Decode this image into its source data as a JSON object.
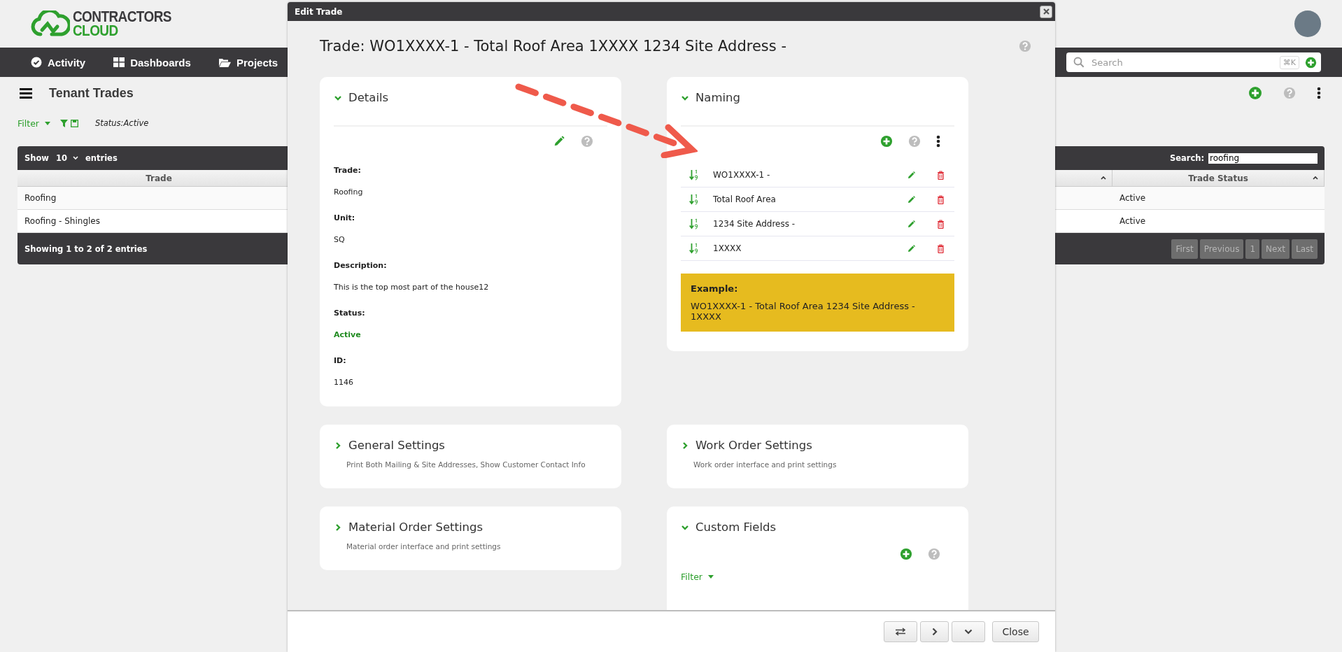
{
  "logo": {
    "line1": "CONTRACTORS",
    "line2": "CLOUD"
  },
  "nav": [
    {
      "label": "Activity",
      "kind": "activity"
    },
    {
      "label": "Dashboards",
      "kind": "dashboards"
    },
    {
      "label": "Projects",
      "kind": "projects"
    }
  ],
  "search": {
    "placeholder": "Search",
    "shortcut": "⌘K"
  },
  "page": {
    "title": "Tenant Trades",
    "filter": "Filter",
    "filter_status": "Status:Active"
  },
  "table": {
    "show_label": "Show",
    "page_size": "10",
    "entries_label": "entries",
    "search_label": "Search:",
    "search_value": "roofing",
    "columns": [
      "Trade",
      "Trade Status"
    ],
    "rows": [
      {
        "trade": "Roofing",
        "status": "Active"
      },
      {
        "trade": "Roofing - Shingles",
        "status": "Active"
      }
    ],
    "info": "Showing 1 to 2 of 2 entries",
    "pagination": [
      "First",
      "Previous",
      "1",
      "Next",
      "Last"
    ]
  },
  "modal": {
    "title": "Edit Trade",
    "heading": "Trade: WO1XXXX-1 - Total Roof Area 1XXXX 1234 Site Address -",
    "details": {
      "title": "Details",
      "expanded": true,
      "fields": [
        {
          "label": "Trade:",
          "value": "Roofing",
          "kind": "text"
        },
        {
          "label": "Unit:",
          "value": "SQ",
          "kind": "text"
        },
        {
          "label": "Description:",
          "value": "This is the top most part of the house12",
          "kind": "text"
        },
        {
          "label": "Status:",
          "value": "Active",
          "kind": "status"
        },
        {
          "label": "ID:",
          "value": "1146",
          "kind": "text"
        }
      ]
    },
    "naming": {
      "title": "Naming",
      "expanded": true,
      "parts": [
        "WO1XXXX-1 -",
        "Total Roof Area",
        "1234 Site Address -",
        "1XXXX"
      ],
      "example_label": "Example:",
      "example": "WO1XXXX-1 - Total Roof Area 1234 Site Address - 1XXXX"
    },
    "general_settings": {
      "title": "General Settings",
      "subtitle": "Print Both Mailing & Site Addresses, Show Customer Contact Info",
      "expanded": false
    },
    "work_order_settings": {
      "title": "Work Order Settings",
      "subtitle": "Work order interface and print settings",
      "expanded": false
    },
    "material_order_settings": {
      "title": "Material Order Settings",
      "subtitle": "Material order interface and print settings",
      "expanded": false
    },
    "custom_fields": {
      "title": "Custom Fields",
      "expanded": true,
      "filter": "Filter"
    },
    "close_button": "Close"
  }
}
